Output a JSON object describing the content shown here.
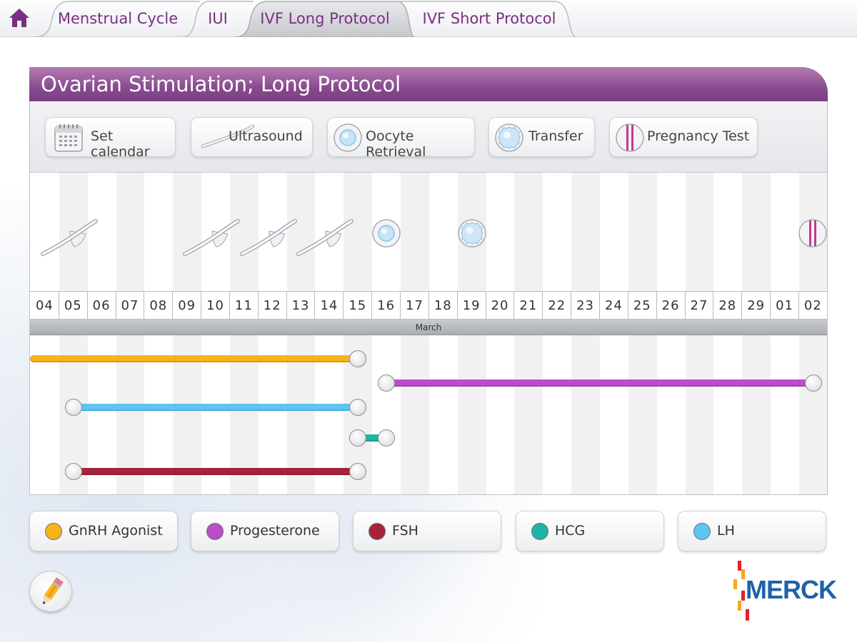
{
  "colors": {
    "accent": "#7b2f83",
    "gnrh": "#f8b21a",
    "progesterone": "#b94ec8",
    "fsh": "#a6233a",
    "hcg": "#1fb3a6",
    "lh": "#5cc5f4"
  },
  "nav": {
    "home_icon": "home-icon",
    "tabs": [
      {
        "label": "Menstrual Cycle"
      },
      {
        "label": "IUI"
      },
      {
        "label": "IVF Long Protocol",
        "active": true
      },
      {
        "label": "IVF Short Protocol"
      }
    ]
  },
  "panel": {
    "title": "Ovarian Stimulation; Long Protocol"
  },
  "toolbar": {
    "set_calendar": "Set calendar",
    "ultrasound": "Ultrasound",
    "oocyte_retrieval": "Oocyte Retrieval",
    "transfer": "Transfer",
    "pregnancy_test": "Pregnancy Test"
  },
  "calendar": {
    "month": "March",
    "dates": [
      "04",
      "05",
      "06",
      "07",
      "08",
      "09",
      "10",
      "11",
      "12",
      "13",
      "14",
      "15",
      "16",
      "17",
      "18",
      "19",
      "20",
      "21",
      "22",
      "23",
      "24",
      "25",
      "26",
      "27",
      "28",
      "29",
      "01",
      "02"
    ],
    "events": [
      {
        "type": "ultrasound",
        "day_index": 1
      },
      {
        "type": "ultrasound",
        "day_index": 6
      },
      {
        "type": "ultrasound",
        "day_index": 8
      },
      {
        "type": "ultrasound",
        "day_index": 10
      },
      {
        "type": "oocyte-retrieval",
        "day_index": 12
      },
      {
        "type": "transfer",
        "day_index": 15
      },
      {
        "type": "pregnancy-test",
        "day_index": 27
      }
    ],
    "treatments": [
      {
        "drug": "gnrh",
        "start_index": 0,
        "end_index": 11,
        "open_start": true
      },
      {
        "drug": "progesterone",
        "start_index": 12,
        "end_index": 27
      },
      {
        "drug": "lh",
        "start_index": 1,
        "end_index": 11
      },
      {
        "drug": "hcg",
        "start_index": 11,
        "end_index": 12
      },
      {
        "drug": "fsh",
        "start_index": 1,
        "end_index": 11
      }
    ]
  },
  "legend": {
    "gnrh": "GnRH Agonist",
    "progesterone": "Progesterone",
    "fsh": "FSH",
    "hcg": "HCG",
    "lh": "LH"
  },
  "edit_icon": "pencil-icon",
  "logo": {
    "text": "MERCK"
  }
}
